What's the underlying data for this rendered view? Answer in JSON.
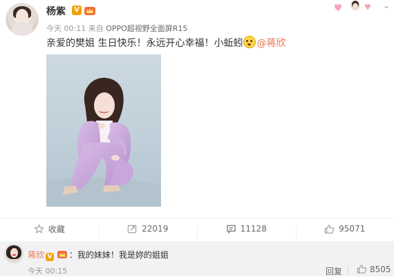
{
  "post": {
    "author": "杨紫",
    "verified_badge": "V",
    "meta_time": "今天 00:11",
    "meta_from": "来自",
    "meta_source": "OPPO超视野全面屏R15",
    "text_main": "亲爱的樊姐 生日快乐！永远开心幸福！小蚯蚓",
    "mention": "@蒋欣",
    "emoji": "[awkward-face]"
  },
  "actions": {
    "favorite_label": "收藏",
    "repost_count": "22019",
    "comment_count": "11128",
    "like_count": "95071"
  },
  "comment": {
    "author": "蒋欣",
    "verified_badge": "V",
    "text": "：我的妹妹！我是妳的姐姐",
    "time": "今天 00:15",
    "reply_label": "回复",
    "like_count": "8505"
  },
  "icons": {
    "favorite": "star-icon",
    "repost": "repost-icon",
    "comment": "comment-icon",
    "like": "thumb-up-icon",
    "more": "chevron-down-icon"
  },
  "colors": {
    "mention": "#eb7350",
    "badge": "#f2a20c",
    "meta": "#999999",
    "comment_bg": "#f2f2f5"
  }
}
